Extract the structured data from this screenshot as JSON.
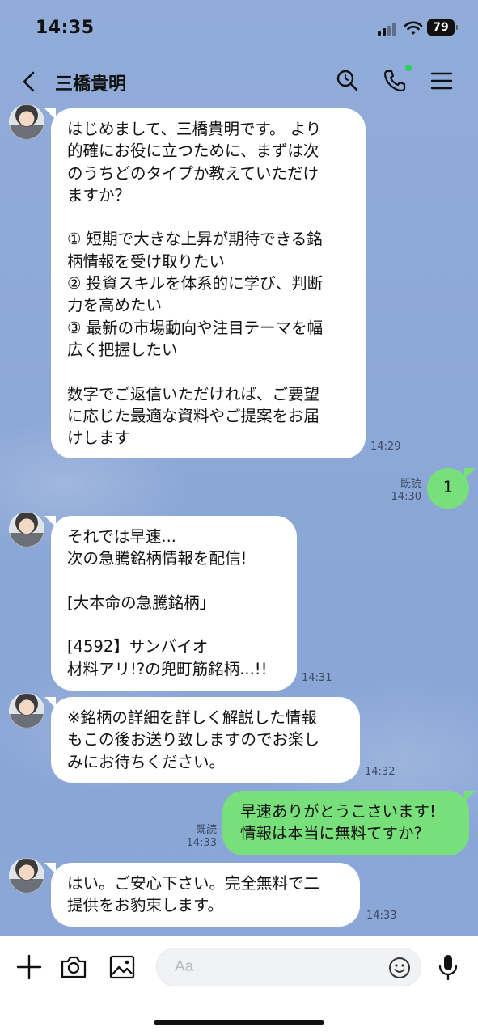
{
  "status_bar": {
    "time": "14:35",
    "battery": "79"
  },
  "header": {
    "title": "三橋貴明"
  },
  "messages": [
    {
      "text": "はじめまして、三橋貴明です。 より\n的確にお役に立つために、まずは次\nのうちどのタイプか教えていただけ\nますか？\n\n① 短期で大きな上昇が期待できる銘\n柄情報を受け取りたい\n② 投資スキルを体系的に学び、判断\n力を高めたい\n③ 最新の市場動向や注目テーマを幅\n広く把握したい\n\n数字でご返信いただければ、ご要望\nに応じた最適な資料やご提案をお届\nけします",
      "time": "14:29"
    },
    {
      "text": "1",
      "read": "既読",
      "time": "14:30"
    },
    {
      "text": "それでは早速...\n次の急騰銘柄情報を配信!\n\n[大本命の急騰銘柄」\n\n[4592】サンバイオ\n材料アリ!?の兜町筋銘柄...!!",
      "time": "14:31"
    },
    {
      "text": "※銘柄の詳細を詳しく解説した情報\nもこの後お送り致しますのでお楽し\nみにお待ちください。",
      "time": "14:32"
    },
    {
      "text": "早速ありがとうこさいます!\n情報は本当に無料てすか?",
      "read": "既読",
      "time": "14:33"
    },
    {
      "text": "はい。ご安心下さい。完全無料で二\n提供をお豹束します。",
      "time": "14:33"
    }
  ],
  "composer": {
    "placeholder": "Aa"
  },
  "icons": [
    "back-icon",
    "search-icon",
    "phone-icon",
    "menu-icon",
    "plus-icon",
    "camera-icon",
    "image-icon",
    "emoji-icon",
    "microphone-icon"
  ]
}
